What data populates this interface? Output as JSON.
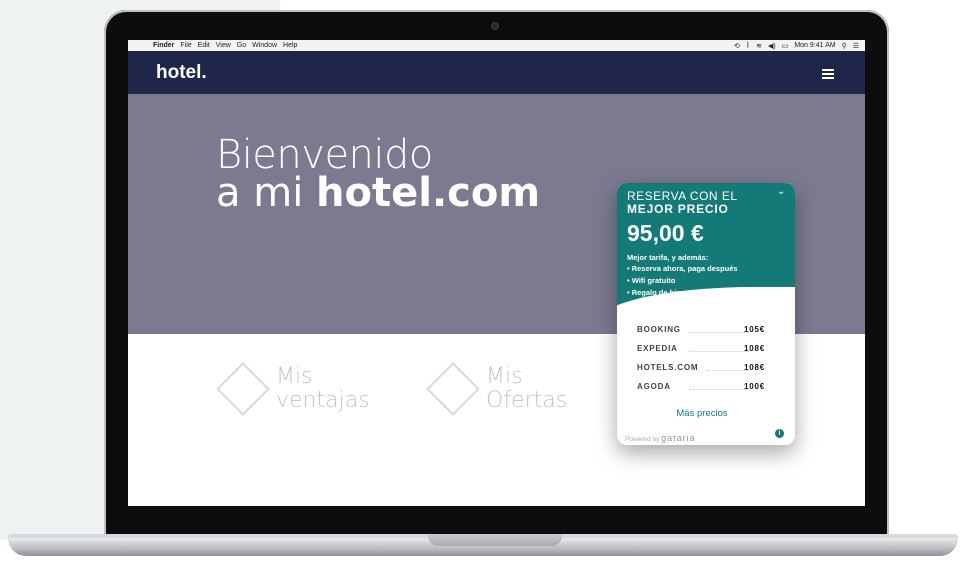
{
  "menubar": {
    "app": "Finder",
    "items": [
      "File",
      "Edit",
      "View",
      "Go",
      "Window",
      "Help"
    ],
    "clock": "Mon 9:41 AM"
  },
  "site": {
    "logo": "hotel.",
    "menu_icon": "hamburger-icon"
  },
  "hero": {
    "line1": "Bienvenido",
    "line2_prefix": "a mi ",
    "line2_bold": "hotel.com"
  },
  "features": [
    {
      "line1": "Mis",
      "line2": "ventajas",
      "icon": "diamond-icon"
    },
    {
      "line1": "Mis",
      "line2": "Ofertas",
      "icon": "diamond-icon"
    }
  ],
  "widget": {
    "title_line1": "RESERVA CON EL",
    "title_line2": "MEJOR PRECIO",
    "price": "95,00 €",
    "subtitle": "Mejor tarifa, y además:",
    "bullets": [
      "• Reserva ahora, paga después",
      "• Wifi gratuito",
      "• Regalo de bienvenida"
    ],
    "competitors": [
      {
        "name": "BOOKING",
        "price": "105€"
      },
      {
        "name": "EXPEDIA",
        "price": "108€"
      },
      {
        "name": "HOTELS.COM",
        "price": "108€"
      },
      {
        "name": "AGODA",
        "price": "100€"
      }
    ],
    "more_label": "Más precios",
    "powered_by": "Powered by",
    "powered_brand": "gataria",
    "accent_color": "#137a77"
  },
  "colors": {
    "header": "#1f2649",
    "hero": "#7c7a90"
  }
}
